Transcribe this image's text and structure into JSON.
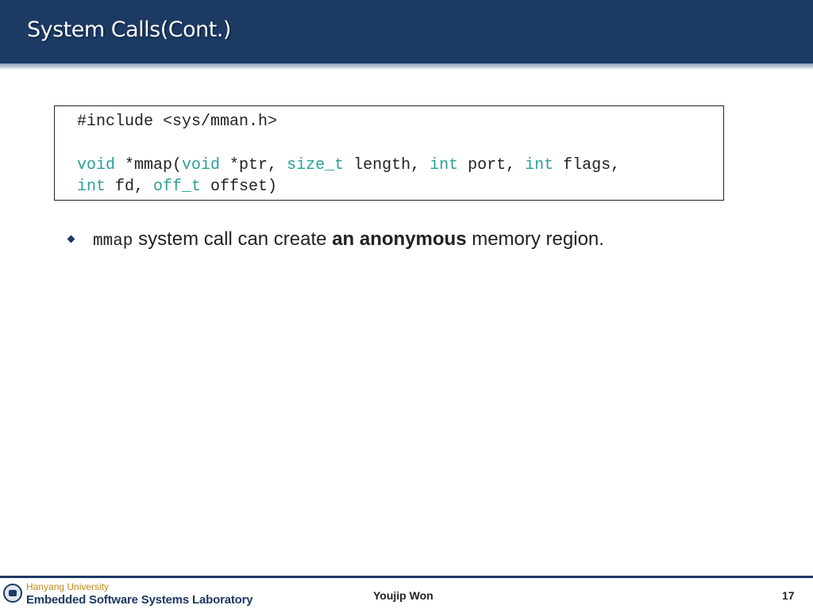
{
  "slide": {
    "title": "System Calls(Cont.)"
  },
  "code": {
    "line1": "#include <sys/mman.h>",
    "line2": [
      {
        "text": "void",
        "kw": true
      },
      {
        "text": " *mmap(",
        "kw": false
      },
      {
        "text": "void",
        "kw": true
      },
      {
        "text": " *ptr, ",
        "kw": false
      },
      {
        "text": "size_t",
        "kw": true
      },
      {
        "text": " length, ",
        "kw": false
      },
      {
        "text": "int",
        "kw": true
      },
      {
        "text": " port, ",
        "kw": false
      },
      {
        "text": "int",
        "kw": true
      },
      {
        "text": " flags,",
        "kw": false
      }
    ],
    "line3": [
      {
        "text": "int",
        "kw": true
      },
      {
        "text": " fd, ",
        "kw": false
      },
      {
        "text": "off_t",
        "kw": true
      },
      {
        "text": " offset)",
        "kw": false
      }
    ],
    "keyword_color": "#2aa198"
  },
  "bullet": {
    "code_term": "mmap",
    "text_before": " system call can create ",
    "bold_text": "an anonymous",
    "text_after": " memory region."
  },
  "footer": {
    "university": "Hanyang University",
    "lab": "Embedded Software Systems Laboratory",
    "author": "Youjip Won",
    "page": "17"
  },
  "colors": {
    "header_bg": "#1c3a64"
  }
}
